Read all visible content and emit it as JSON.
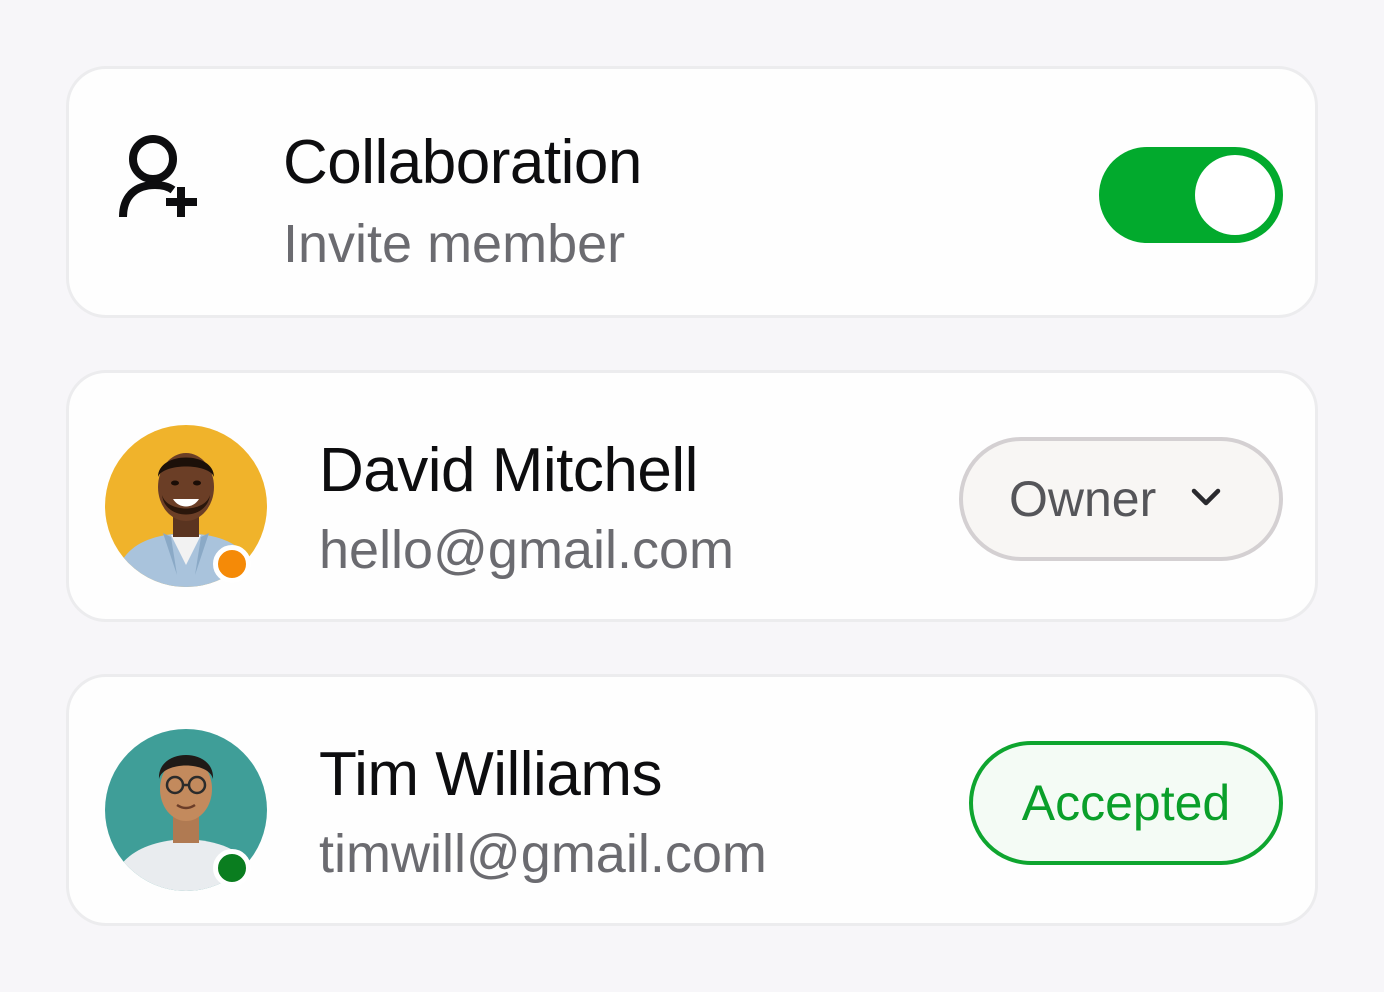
{
  "collaboration": {
    "icon": "user-plus-icon",
    "title": "Collaboration",
    "subtitle": "Invite member",
    "toggle_on": true,
    "toggle_color": "#02aa2d"
  },
  "members": [
    {
      "name": "David Mitchell",
      "email": "hello@gmail.com",
      "status_color": "#f58a07",
      "avatar_bg": "#f0b32b",
      "role": "Owner",
      "role_icon": "chevron-down-icon"
    },
    {
      "name": "Tim Williams",
      "email": "timwill@gmail.com",
      "status_color": "#0a7d1f",
      "avatar_bg": "#3f9e98",
      "status": "Accepted",
      "status_badge_color": "#0ea52f"
    }
  ]
}
